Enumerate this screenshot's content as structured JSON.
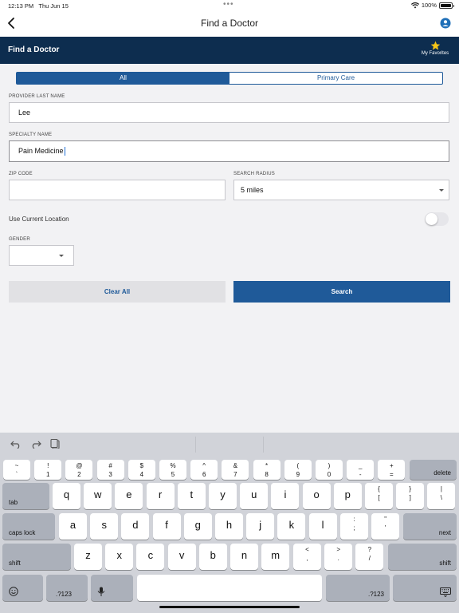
{
  "status_bar": {
    "time": "12:13 PM",
    "date": "Thu Jun 15",
    "battery": "100%",
    "battery_level": 1.0
  },
  "nav": {
    "title": "Find a Doctor",
    "back_icon": "chevron-left-icon",
    "profile_icon": "person-circle-icon"
  },
  "header": {
    "title": "Find a Doctor",
    "favorites_label": "My Favorites",
    "favorites_icon": "star-icon",
    "star_color": "#f5c518"
  },
  "tabs": {
    "all": "All",
    "primary_care": "Primary Care",
    "selected": "All"
  },
  "form": {
    "provider_last_name": {
      "label": "PROVIDER LAST NAME",
      "value": "Lee"
    },
    "specialty_name": {
      "label": "SPECIALTY NAME",
      "value": "Pain Medicine"
    },
    "zip_code": {
      "label": "ZIP CODE",
      "value": ""
    },
    "search_radius": {
      "label": "SEARCH RADIUS",
      "value": "5 miles"
    },
    "use_current_location": {
      "label": "Use Current Location",
      "on": false
    },
    "gender": {
      "label": "GENDER",
      "value": ""
    }
  },
  "buttons": {
    "clear": "Clear All",
    "search": "Search"
  },
  "colors": {
    "header_bg": "#0d2d4f",
    "accent": "#1f5a99"
  },
  "keyboard": {
    "number_row": [
      {
        "top": "~",
        "bot": "`"
      },
      {
        "top": "!",
        "bot": "1"
      },
      {
        "top": "@",
        "bot": "2"
      },
      {
        "top": "#",
        "bot": "3"
      },
      {
        "top": "$",
        "bot": "4"
      },
      {
        "top": "%",
        "bot": "5"
      },
      {
        "top": "^",
        "bot": "6"
      },
      {
        "top": "&",
        "bot": "7"
      },
      {
        "top": "*",
        "bot": "8"
      },
      {
        "top": "(",
        "bot": "9"
      },
      {
        "top": ")",
        "bot": "0"
      },
      {
        "top": "_",
        "bot": "-"
      },
      {
        "top": "+",
        "bot": "="
      }
    ],
    "delete": "delete",
    "tab": "tab",
    "row_q": [
      "q",
      "w",
      "e",
      "r",
      "t",
      "y",
      "u",
      "i",
      "o",
      "p"
    ],
    "row_q_extra": [
      {
        "top": "{",
        "bot": "["
      },
      {
        "top": "}",
        "bot": "]"
      },
      {
        "top": "|",
        "bot": "\\"
      }
    ],
    "caps_lock": "caps lock",
    "row_a": [
      "a",
      "s",
      "d",
      "f",
      "g",
      "h",
      "j",
      "k",
      "l"
    ],
    "row_a_extra": [
      {
        "top": ":",
        "bot": ";"
      },
      {
        "top": "\"",
        "bot": "'"
      }
    ],
    "next": "next",
    "shift": "shift",
    "row_z": [
      "z",
      "x",
      "c",
      "v",
      "b",
      "n",
      "m"
    ],
    "row_z_extra": [
      {
        "top": "<",
        "bot": ","
      },
      {
        "top": ">",
        "bot": "."
      },
      {
        "top": "?",
        "bot": "/"
      }
    ],
    "numbers_key": ".?123",
    "icons": [
      "undo-icon",
      "redo-icon",
      "clipboard-icon",
      "emoji-icon",
      "microphone-icon",
      "keyboard-dismiss-icon"
    ]
  }
}
